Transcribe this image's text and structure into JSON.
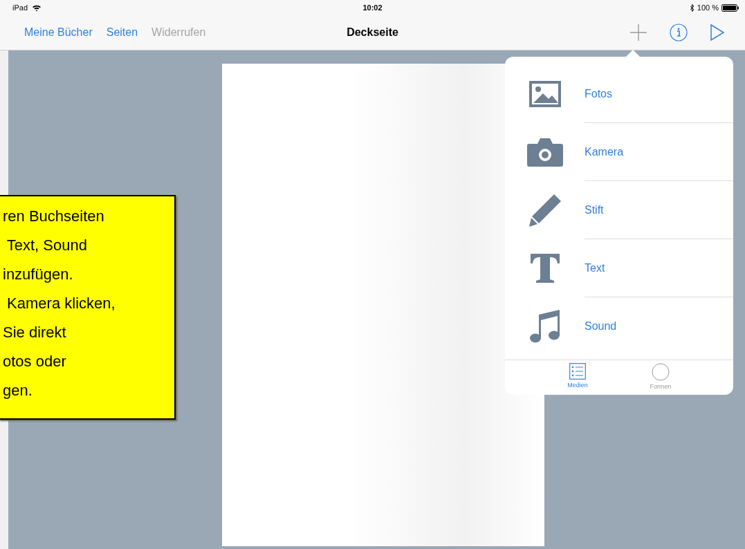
{
  "status_bar": {
    "device": "iPad",
    "time": "10:02",
    "battery": "100 %"
  },
  "nav_bar": {
    "buttons": [
      {
        "label": "Meine Bücher",
        "disabled": false
      },
      {
        "label": "Seiten",
        "disabled": false
      },
      {
        "label": "Widerrufen",
        "disabled": true
      }
    ],
    "title": "Deckseite"
  },
  "popover": {
    "items": [
      {
        "kind": "photos",
        "label": "Fotos"
      },
      {
        "kind": "camera",
        "label": "Kamera"
      },
      {
        "kind": "pen",
        "label": "Stift"
      },
      {
        "kind": "text",
        "label": "Text"
      },
      {
        "kind": "sound",
        "label": "Sound"
      }
    ],
    "tabs": [
      {
        "kind": "list",
        "label": "Medien",
        "selected": true
      },
      {
        "kind": "circle",
        "label": "Formen",
        "selected": false
      }
    ]
  },
  "callout": {
    "lines": [
      "ren Buchseiten",
      " Text, Sound",
      "inzufügen.",
      " Kamera klicken,",
      "Sie direkt",
      "otos oder",
      "gen."
    ]
  }
}
